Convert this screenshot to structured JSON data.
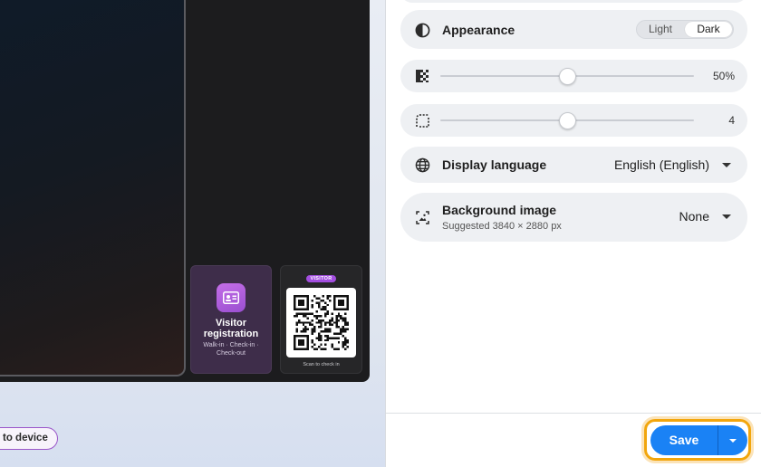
{
  "preview": {
    "visitor_card": {
      "title": "Visitor registration",
      "subtitle": "Walk-in · Check-in · Check-out"
    },
    "qr_card": {
      "badge": "VISITOR",
      "caption": "Scan to check in"
    },
    "send_button_label": "to device"
  },
  "settings": {
    "appearance": {
      "label": "Appearance",
      "options": [
        "Light",
        "Dark"
      ],
      "selected": "Dark"
    },
    "opacity": {
      "value_label": "50%",
      "value": 0.5
    },
    "radius": {
      "value_label": "4",
      "fraction": 0.5
    },
    "language": {
      "label": "Display language",
      "value": "English (English)"
    },
    "background": {
      "label": "Background image",
      "hint": "Suggested 3840 × 2880 px",
      "value": "None"
    }
  },
  "footer": {
    "save_label": "Save"
  },
  "colors": {
    "accent": "#1a82f5",
    "focus": "#f2a60d",
    "visitor_purple": "#a34ee0"
  }
}
